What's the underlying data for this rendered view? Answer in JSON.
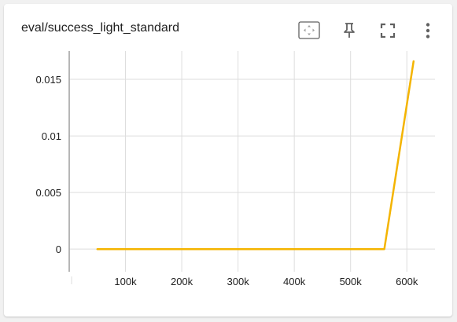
{
  "card": {
    "title": "eval/success_light_standard"
  },
  "toolbar": {
    "icons": [
      "fit-domain-icon",
      "pin-icon",
      "fullscreen-icon",
      "more-vert-icon"
    ]
  },
  "colors": {
    "series": "#f4b400",
    "grid": "#dddddd",
    "axis": "#9e9e9e",
    "icon": "#616161"
  },
  "chart_data": {
    "type": "line",
    "title": "eval/success_light_standard",
    "xlabel": "",
    "ylabel": "",
    "xlim": [
      0,
      650000
    ],
    "ylim": [
      -0.002,
      0.0175
    ],
    "x_ticks": [
      100000,
      200000,
      300000,
      400000,
      500000,
      600000
    ],
    "x_tick_labels": [
      "100k",
      "200k",
      "300k",
      "400k",
      "500k",
      "600k"
    ],
    "y_ticks": [
      0,
      0.005,
      0.01,
      0.015
    ],
    "y_tick_labels": [
      "0",
      "0.005",
      "0.01",
      "0.015"
    ],
    "grid": true,
    "series": [
      {
        "x": [
          50000,
          560000,
          612000
        ],
        "y": [
          0,
          0,
          0.0166
        ]
      }
    ]
  }
}
